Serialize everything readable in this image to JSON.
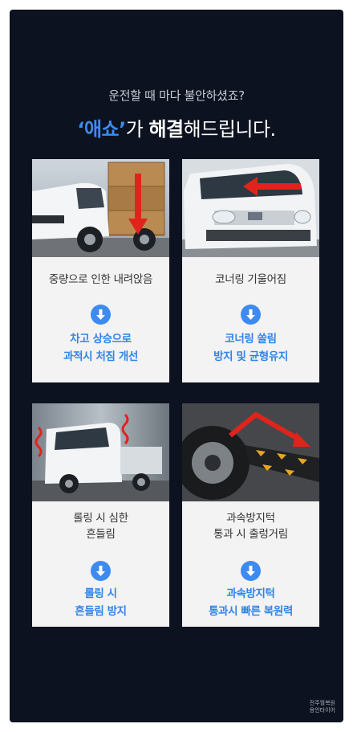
{
  "header": {
    "subtitle": "운전할 때 마다 불안하셨죠?",
    "headline_brand": "‘애쇼’",
    "headline_mid": "가 ",
    "headline_strong": "해결",
    "headline_end": "해드립니다."
  },
  "cards": [
    {
      "problem": [
        "중량으로 인한 내려앉음"
      ],
      "solution": [
        "차고 상승으로",
        "과적시 처짐 개선"
      ],
      "photo_icon": "overloaded-truck-photo"
    },
    {
      "problem": [
        "코너링 기울어짐"
      ],
      "solution": [
        "코너링 쏠림",
        "방지 및 균형유지"
      ],
      "photo_icon": "truck-cornering-photo"
    },
    {
      "problem": [
        "롤링 시 심한",
        "흔들림"
      ],
      "solution": [
        "롤링 시",
        "흔들림 방지"
      ],
      "photo_icon": "truck-rolling-photo"
    },
    {
      "problem": [
        "과속방지턱",
        "통과 시 출렁거림"
      ],
      "solution": [
        "과속방지턱",
        "통과시 빠른 복원력"
      ],
      "photo_icon": "speed-bump-photo"
    }
  ],
  "watermark": [
    "전주월복원",
    "용인타이어"
  ],
  "colors": {
    "background": "#0d1220",
    "accent": "#3d8bf0",
    "card": "#f3f3f3",
    "highlight_red": "#e0241b"
  }
}
